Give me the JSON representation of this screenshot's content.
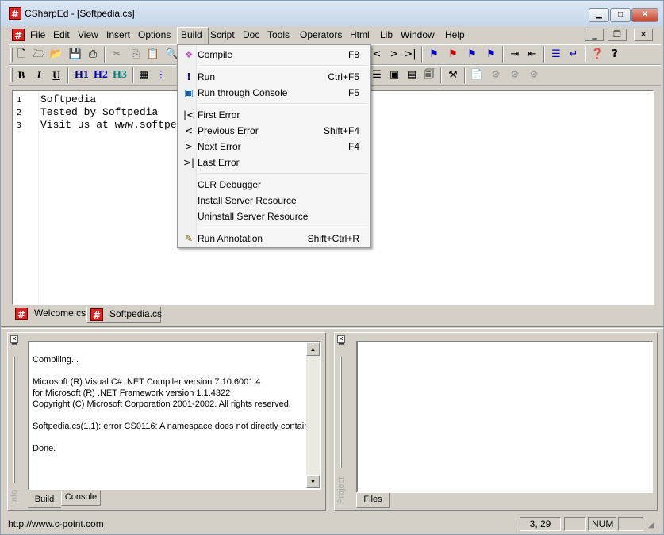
{
  "window": {
    "title": "CSharpEd - [Softpedia.cs]"
  },
  "menubar": {
    "items": [
      {
        "label": "File",
        "u": "F"
      },
      {
        "label": "Edit",
        "u": "E"
      },
      {
        "label": "View",
        "u": "V"
      },
      {
        "label": "Insert",
        "u": "I"
      },
      {
        "label": "Options",
        "u": "O"
      },
      {
        "label": "Build",
        "u": "B"
      },
      {
        "label": "Script",
        "u": "S"
      },
      {
        "label": "Doc",
        "u": "D"
      },
      {
        "label": "Tools",
        "u": "T"
      },
      {
        "label": "Operators",
        "u": "p"
      },
      {
        "label": "Html",
        "u": "m"
      },
      {
        "label": "Lib",
        "u": "L"
      },
      {
        "label": "Window",
        "u": "W"
      },
      {
        "label": "Help",
        "u": "H"
      }
    ]
  },
  "format_toolbar": {
    "b": "B",
    "i": "I",
    "u": "U",
    "h1": "H1",
    "h2": "H2",
    "h3": "H3"
  },
  "editor": {
    "lines": [
      {
        "n": "1",
        "text": "Softpedia"
      },
      {
        "n": "2",
        "text": "Tested by Softpedia"
      },
      {
        "n": "3",
        "text": "Visit us at www.softpe"
      }
    ]
  },
  "doc_tabs": [
    {
      "label": "Welcome.cs"
    },
    {
      "label": "Softpedia.cs"
    }
  ],
  "build_menu": {
    "items": [
      {
        "label": "Compile",
        "shortcut": "F8",
        "icon": "compile-icon"
      },
      {
        "label": "Run",
        "shortcut": "Ctrl+F5",
        "icon": "run-icon"
      },
      {
        "label": "Run through Console",
        "shortcut": "F5",
        "icon": "console-icon"
      },
      {
        "label": "First Error",
        "shortcut": "",
        "icon": "first-error-icon"
      },
      {
        "label": "Previous Error",
        "shortcut": "Shift+F4",
        "icon": "previous-error-icon"
      },
      {
        "label": "Next Error",
        "shortcut": "F4",
        "icon": "next-error-icon"
      },
      {
        "label": "Last Error",
        "shortcut": "",
        "icon": "last-error-icon"
      },
      {
        "label": "CLR Debugger",
        "shortcut": "",
        "icon": ""
      },
      {
        "label": "Install Server Resource",
        "shortcut": "",
        "icon": ""
      },
      {
        "label": "Uninstall Server Resource",
        "shortcut": "",
        "icon": ""
      },
      {
        "label": "Run Annotation",
        "shortcut": "Shift+Ctrl+R",
        "icon": "annotation-icon"
      }
    ]
  },
  "output_panel": {
    "label": "Info",
    "lines": [
      "Compiling...",
      "",
      "Microsoft (R) Visual C# .NET Compiler version 7.10.6001.4",
      "for Microsoft (R) .NET Framework version 1.1.4322",
      "Copyright (C) Microsoft Corporation 2001-2002. All rights reserved.",
      "",
      "Softpedia.cs(1,1): error CS0116: A namespace does not directly contain",
      "",
      "Done."
    ],
    "tabs": [
      {
        "label": "Build"
      },
      {
        "label": "Console"
      }
    ]
  },
  "project_panel": {
    "label": "Project",
    "tabs": [
      {
        "label": "Files"
      }
    ]
  },
  "statusbar": {
    "url": "http://www.c-point.com",
    "position": "3, 29",
    "num": "NUM"
  }
}
